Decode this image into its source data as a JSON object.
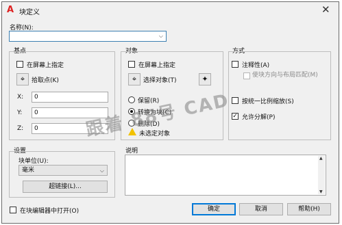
{
  "title": "块定义",
  "name": {
    "label": "名称(N):",
    "value": ""
  },
  "base_point": {
    "group_label": "基点",
    "specify_on_screen": "在屏幕上指定",
    "pick_point_btn": "拾取点(K)",
    "x_label": "X:",
    "x_value": "0",
    "y_label": "Y:",
    "y_value": "0",
    "z_label": "Z:",
    "z_value": "0"
  },
  "objects": {
    "group_label": "对象",
    "specify_on_screen": "在屏幕上指定",
    "select_objects_btn": "选择对象(T)",
    "retain": "保留(R)",
    "convert": "转换为块(C)",
    "delete": "删除(D)",
    "warning": "未选定对象"
  },
  "behavior": {
    "group_label": "方式",
    "annotative": "注释性(A)",
    "match_orientation": "使块方向与布局匹配(M)",
    "scale_uniformly": "按统一比例缩放(S)",
    "allow_exploding": "允许分解(P)"
  },
  "settings": {
    "group_label": "设置",
    "unit_label": "块单位(U):",
    "unit_value": "毫米",
    "hyperlink_btn": "超链接(L)..."
  },
  "description": {
    "label": "说明",
    "value": ""
  },
  "open_in_editor": "在块编辑器中打开(O)",
  "buttons": {
    "ok": "确定",
    "cancel": "取消",
    "help": "帮助(H)"
  },
  "watermark": "跟着 88号 CAD",
  "colors": {
    "accent": "#0078d7",
    "title_icon": "#d22222",
    "warning": "#f2c200"
  }
}
